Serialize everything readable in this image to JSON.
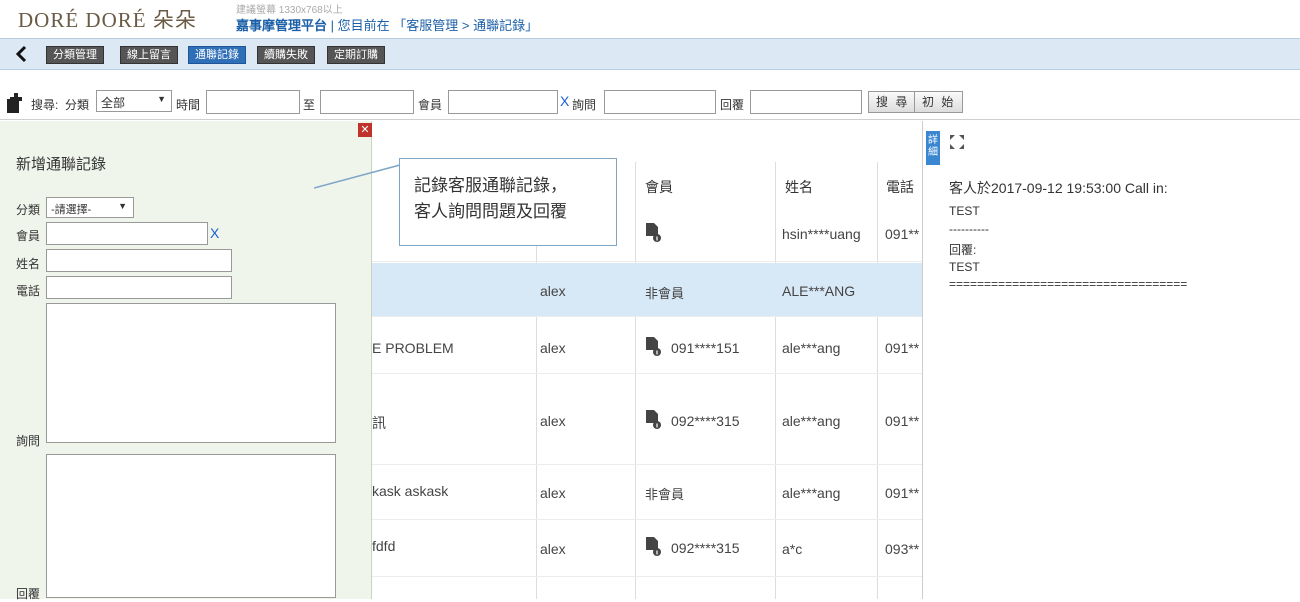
{
  "header": {
    "logo": "DORÉ DORÉ 朵朵",
    "resolution_note": "建議螢幕 1330x768以上",
    "platform_name": "嘉事摩管理平台",
    "location_prefix": "| 您目前在",
    "location": "「客服管理 > 通聯記錄」"
  },
  "toolbar": {
    "buttons": [
      {
        "label": "分類管理",
        "active": false
      },
      {
        "label": "線上留言",
        "active": false
      },
      {
        "label": "通聯記錄",
        "active": true
      },
      {
        "label": "續購失敗",
        "active": false
      },
      {
        "label": "定期訂購",
        "active": false
      }
    ]
  },
  "search": {
    "search_label": "搜尋:",
    "category_label": "分類",
    "category_value": "全部",
    "time_label": "時間",
    "to_label": "至",
    "member_label": "會員",
    "clear_x": "X",
    "inquiry_label": "詢問",
    "reply_label": "回覆",
    "search_button": "搜 尋",
    "reset_button": "初 始"
  },
  "panel": {
    "title": "新增通聯記錄",
    "close": "✕",
    "category_label": "分類",
    "category_value": "-請選擇-",
    "member_label": "會員",
    "clear_x": "X",
    "name_label": "姓名",
    "phone_label": "電話",
    "inquiry_label": "詢問",
    "reply_label": "回覆"
  },
  "callout": {
    "line1": "記錄客服通聯記錄，",
    "line2": "客人詢問問題及回覆"
  },
  "table": {
    "headers": {
      "member": "會員",
      "name": "姓名",
      "phone": "電話"
    },
    "rows": [
      {
        "content": "",
        "staff": "",
        "member": "",
        "member_icon": true,
        "name": "hsin****uang",
        "phone": "091**"
      },
      {
        "content": "",
        "staff": "alex",
        "member": "非會員",
        "member_icon": false,
        "name": "ALE***ANG",
        "phone": ""
      },
      {
        "content": "E PROBLEM",
        "staff": "alex",
        "member": "091****151",
        "member_icon": true,
        "name": "ale***ang",
        "phone": "091**"
      },
      {
        "content": "訊",
        "staff": "alex",
        "member": "092****315",
        "member_icon": true,
        "name": "ale***ang",
        "phone": "091**"
      },
      {
        "content": "kask askask",
        "staff": "alex",
        "member": "非會員",
        "member_icon": false,
        "name": "ale***ang",
        "phone": "091**"
      },
      {
        "content": "fdfd",
        "staff": "alex",
        "member": "092****315",
        "member_icon": true,
        "name": "a*c",
        "phone": "093**"
      }
    ]
  },
  "detail": {
    "tab_label": "詳細",
    "call_line": "客人於2017-09-12 19:53:00 Call in:",
    "inquiry_text": "TEST",
    "dashes": "----------",
    "reply_label": "回覆:",
    "reply_text": "TEST",
    "separator": "=================================="
  },
  "colors": {
    "accent": "#2f6fb7",
    "toolbar_bg": "#dce9f5",
    "panel_bg": "#f0f5ec",
    "selected_row": "#d7e8f7"
  }
}
